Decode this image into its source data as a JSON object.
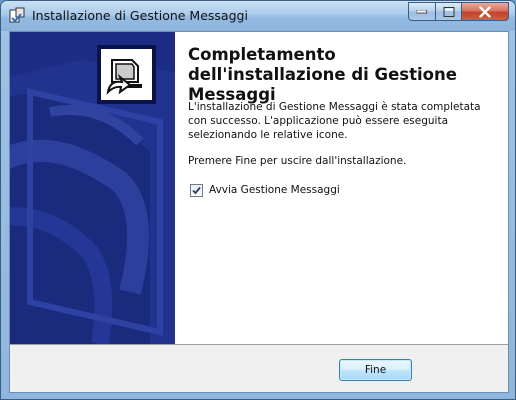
{
  "window": {
    "title": "Installazione di Gestione Messaggi",
    "icons": {
      "app": "installer-icon",
      "minimize": "minimize-icon",
      "maximize": "maximize-icon",
      "close": "close-icon"
    }
  },
  "wizard": {
    "heading": "Completamento dell'installazione di Gestione Messaggi",
    "paragraph1": "L'installazione di Gestione Messaggi è stata completata con successo. L'applicazione può essere eseguita selezionando le relative icone.",
    "paragraph2": "Premere Fine per uscire dall'installazione.",
    "checkbox": {
      "label": "Avvia Gestione Messaggi",
      "checked": true
    },
    "banner_icon": "installer-logo-icon"
  },
  "footer": {
    "finish_label": "Fine"
  },
  "colors": {
    "banner": "#1b2a80",
    "accent": "#3c7fb1"
  }
}
